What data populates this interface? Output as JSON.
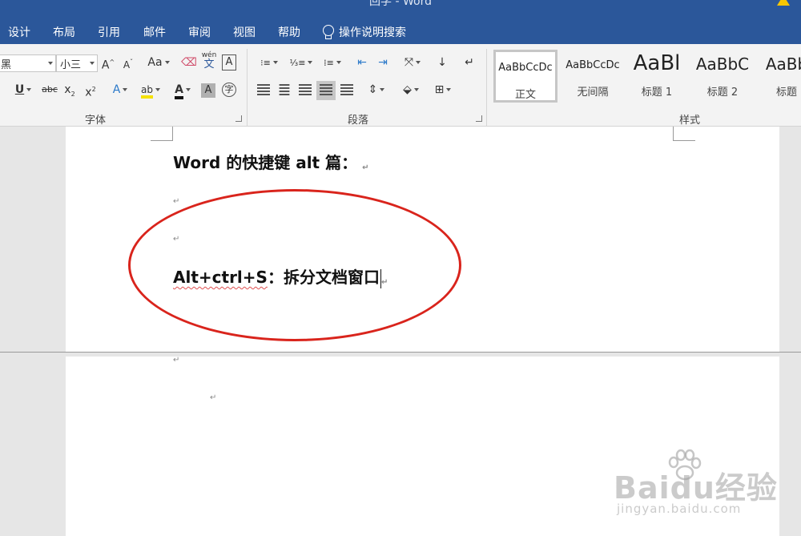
{
  "window": {
    "title": "回学 - Word"
  },
  "tabs": [
    {
      "label": "设计"
    },
    {
      "label": "布局"
    },
    {
      "label": "引用"
    },
    {
      "label": "邮件"
    },
    {
      "label": "审阅"
    },
    {
      "label": "视图"
    },
    {
      "label": "帮助"
    }
  ],
  "tell_me": "操作说明搜索",
  "ribbon": {
    "font": {
      "name": "黑",
      "size": "小三",
      "group_label": "字体",
      "change_case": "Aa",
      "phonetic_top": "wén",
      "phonetic_bottom": "文"
    },
    "paragraph": {
      "group_label": "段落"
    },
    "styles": {
      "group_label": "样式",
      "items": [
        {
          "sample": "AaBbCcDc",
          "name": "正文"
        },
        {
          "sample": "AaBbCcDc",
          "name": "无间隔"
        },
        {
          "sample": "AaBl",
          "name": "标题 1"
        },
        {
          "sample": "AaBbC",
          "name": "标题 2"
        },
        {
          "sample": "AaBb",
          "name": "标题"
        }
      ]
    }
  },
  "document": {
    "heading": "Word  的快捷键 alt 篇：",
    "shortcut_key": "Alt+ctrl+S",
    "shortcut_desc": "：拆分文档窗口",
    "para_mark": "↵"
  },
  "watermark": {
    "brand": "Baidu经验",
    "url": "jingyan.baidu.com"
  },
  "colors": {
    "accent": "#2b579a",
    "highlight_circle": "#d9241c"
  }
}
